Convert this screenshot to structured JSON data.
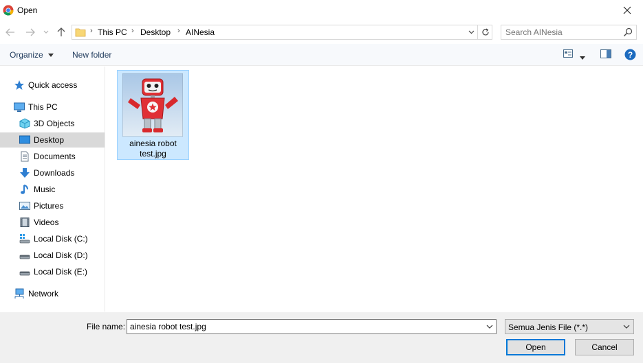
{
  "window": {
    "title": "Open"
  },
  "nav": {
    "breadcrumb": [
      "This PC",
      "Desktop",
      "AINesia"
    ],
    "search_placeholder": "Search AINesia"
  },
  "toolbar": {
    "organize_label": "Organize",
    "new_folder_label": "New folder"
  },
  "sidebar": {
    "items": [
      {
        "label": "Quick access",
        "icon": "star-icon"
      },
      {
        "label": "This PC",
        "icon": "computer-icon"
      },
      {
        "label": "3D Objects",
        "icon": "cube-icon"
      },
      {
        "label": "Desktop",
        "icon": "desktop-icon",
        "selected": true
      },
      {
        "label": "Documents",
        "icon": "document-icon"
      },
      {
        "label": "Downloads",
        "icon": "download-arrow-icon"
      },
      {
        "label": "Music",
        "icon": "music-note-icon"
      },
      {
        "label": "Pictures",
        "icon": "picture-icon"
      },
      {
        "label": "Videos",
        "icon": "film-icon"
      },
      {
        "label": "Local Disk (C:)",
        "icon": "system-drive-icon"
      },
      {
        "label": "Local Disk (D:)",
        "icon": "drive-icon"
      },
      {
        "label": "Local Disk (E:)",
        "icon": "drive-icon"
      },
      {
        "label": "Network",
        "icon": "network-icon"
      }
    ]
  },
  "files": [
    {
      "name_line1": "ainesia robot",
      "name_line2": "test.jpg",
      "selected": true
    }
  ],
  "footer": {
    "file_name_label": "File name:",
    "file_name_value": "ainesia robot test.jpg",
    "file_type_value": "Semua Jenis File (*.*)",
    "open_label": "Open",
    "cancel_label": "Cancel"
  },
  "colors": {
    "accent": "#0078d7",
    "selection": "#cce8ff",
    "sidebar_selected": "#d9d9d9"
  }
}
